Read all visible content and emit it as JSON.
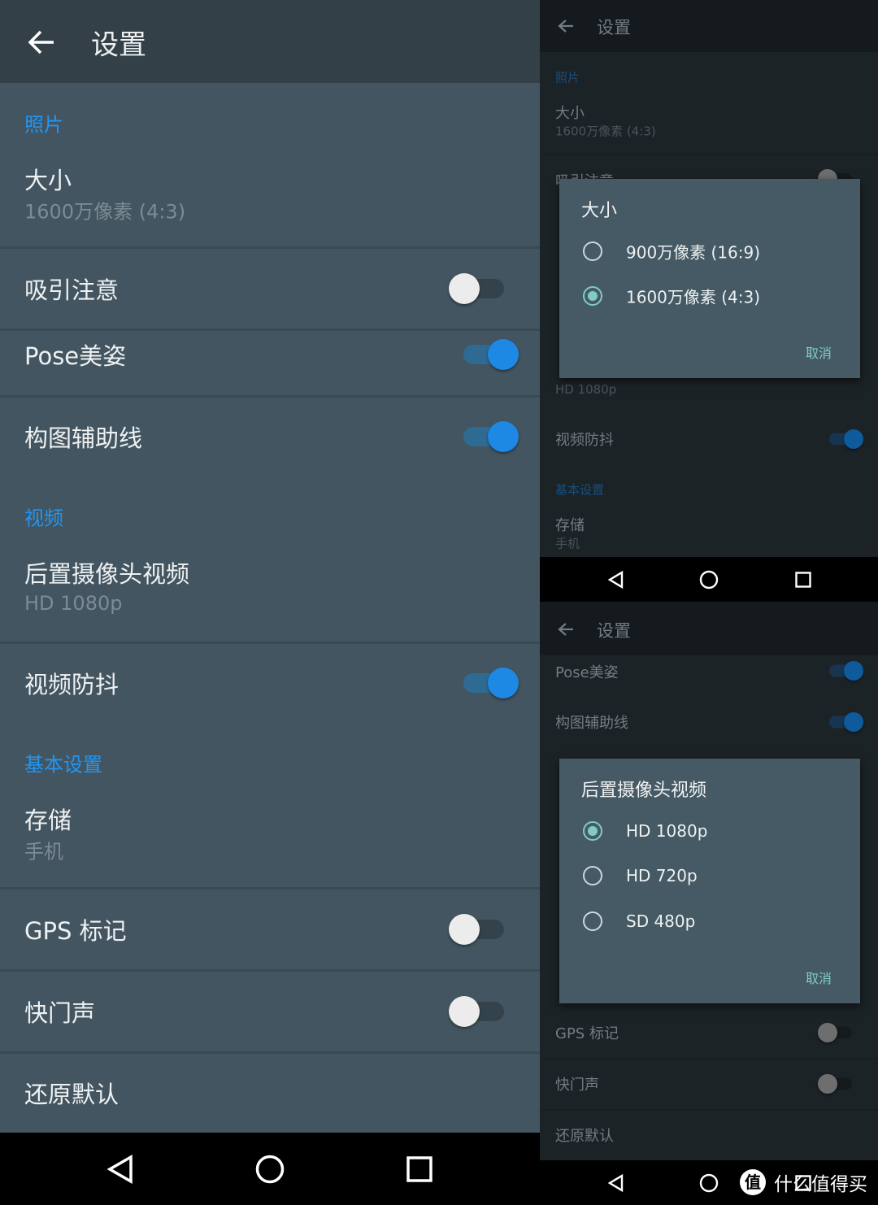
{
  "colors": {
    "accent": "#2196f3",
    "header": "#334047",
    "background": "#435560",
    "dialog": "#455a64",
    "dialog_accent": "#80cbc4"
  },
  "left": {
    "title": "设置",
    "sections": {
      "photo": "照片",
      "video": "视频",
      "basic": "基本设置"
    },
    "size": {
      "title": "大小",
      "value": "1600万像素 (4:3)"
    },
    "attention": {
      "title": "吸引注意",
      "on": false
    },
    "pose": {
      "title": "Pose美姿",
      "on": true
    },
    "grid": {
      "title": "构图辅助线",
      "on": true
    },
    "rear_video": {
      "title": "后置摄像头视频",
      "value": "HD 1080p"
    },
    "stabilize": {
      "title": "视频防抖",
      "on": true
    },
    "storage": {
      "title": "存储",
      "value": "手机"
    },
    "gps": {
      "title": "GPS 标记",
      "on": false
    },
    "shutter": {
      "title": "快门声",
      "on": false
    },
    "reset": {
      "title": "还原默认"
    }
  },
  "right_top": {
    "title": "设置",
    "section_photo": "照片",
    "size_title": "大小",
    "size_value": "1600万像素 (4:3)",
    "attention": "吸引注意",
    "video_value": "HD 1080p",
    "stabilize": "视频防抖",
    "section_basic": "基本设置",
    "storage": "存储",
    "storage_value": "手机",
    "dialog": {
      "title": "大小",
      "options": [
        {
          "label": "900万像素 (16:9)",
          "selected": false
        },
        {
          "label": "1600万像素 (4:3)",
          "selected": true
        }
      ],
      "cancel": "取消"
    }
  },
  "right_bottom": {
    "title": "设置",
    "pose": "Pose美姿",
    "grid": "构图辅助线",
    "gps": "GPS 标记",
    "shutter": "快门声",
    "reset": "还原默认",
    "dialog": {
      "title": "后置摄像头视频",
      "options": [
        {
          "label": "HD 1080p",
          "selected": true
        },
        {
          "label": "HD 720p",
          "selected": false
        },
        {
          "label": "SD 480p",
          "selected": false
        }
      ],
      "cancel": "取消"
    }
  },
  "watermark": "什么值得买"
}
